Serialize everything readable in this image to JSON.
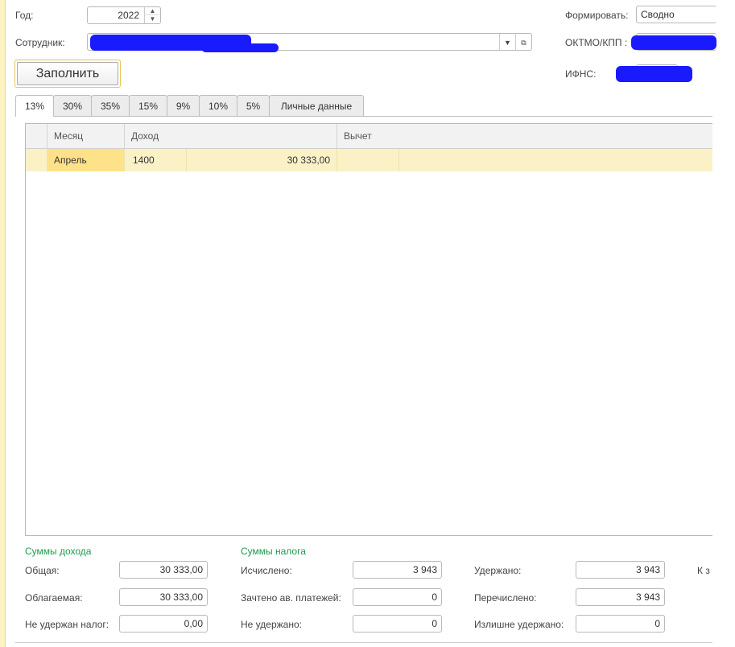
{
  "header": {
    "year_label": "Год:",
    "year_value": "2022",
    "employee_label": "Сотрудник:",
    "fill_button": "Заполнить",
    "form_label": "Формировать:",
    "form_value": "Сводно",
    "oktmo_label": "ОКТМО/КПП :",
    "ifns_label": "ИФНС:"
  },
  "tabs": [
    {
      "label": "13%",
      "active": true
    },
    {
      "label": "30%"
    },
    {
      "label": "35%"
    },
    {
      "label": "15%"
    },
    {
      "label": "9%"
    },
    {
      "label": "10%"
    },
    {
      "label": "5%"
    },
    {
      "label": "Личные данные"
    }
  ],
  "table": {
    "columns": [
      "Месяц",
      "Доход",
      "Вычет"
    ],
    "rows": [
      {
        "month": "Апрель",
        "code": "1400",
        "amount": "30 333,00",
        "deduction": ""
      }
    ]
  },
  "income": {
    "title": "Суммы дохода",
    "total_label": "Общая:",
    "total_value": "30 333,00",
    "taxable_label": "Облагаемая:",
    "taxable_value": "30 333,00",
    "not_withheld_label": "Не удержан налог:",
    "not_withheld_value": "0,00"
  },
  "tax": {
    "title": "Суммы налога",
    "calculated_label": "Исчислено:",
    "calculated_value": "3 943",
    "advance_label": "Зачтено ав. платежей:",
    "advance_value": "0",
    "not_withheld_label": "Не удержано:",
    "not_withheld_value": "0",
    "withheld_label": "Удержано:",
    "withheld_value": "3 943",
    "transferred_label": "Перечислено:",
    "transferred_value": "3 943",
    "excess_label": "Излишне удержано:",
    "excess_value": "0",
    "cut_label": "К з"
  },
  "colors": {
    "accent_green": "#1e9a4e",
    "row_highlight": "#fbf1c7",
    "redaction": "#1a1aff"
  }
}
